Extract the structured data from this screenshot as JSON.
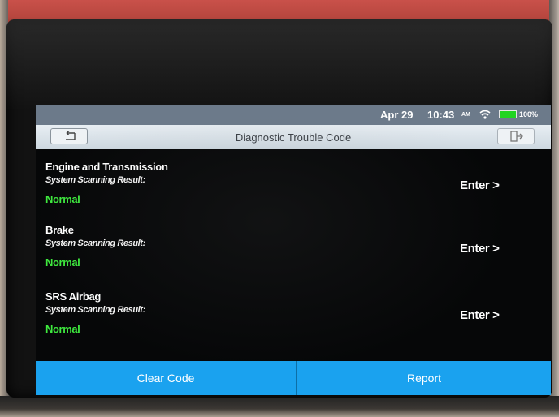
{
  "status_bar": {
    "date": "Apr 29",
    "time": "10:43",
    "ampm": "AM",
    "battery_percent": "100%",
    "battery_level": 1.0,
    "wifi_icon": "wifi-icon",
    "battery_icon": "battery-icon"
  },
  "title_bar": {
    "title": "Diagnostic Trouble Code",
    "back_icon": "back-arrow-icon",
    "exit_icon": "exit-icon"
  },
  "systems": [
    {
      "name": "Engine and Transmission",
      "result_label": "System Scanning Result:",
      "status": "Normal",
      "action": "Enter >"
    },
    {
      "name": "Brake",
      "result_label": "System Scanning Result:",
      "status": "Normal",
      "action": "Enter >"
    },
    {
      "name": "SRS Airbag",
      "result_label": "System Scanning Result:",
      "status": "Normal",
      "action": "Enter >"
    }
  ],
  "buttons": {
    "clear_code": "Clear Code",
    "report": "Report"
  },
  "colors": {
    "status_normal": "#3ee93e",
    "button_bar": "#1aa2ef",
    "status_bar": "#6c7a8a",
    "device_casing": "#b8473f"
  }
}
